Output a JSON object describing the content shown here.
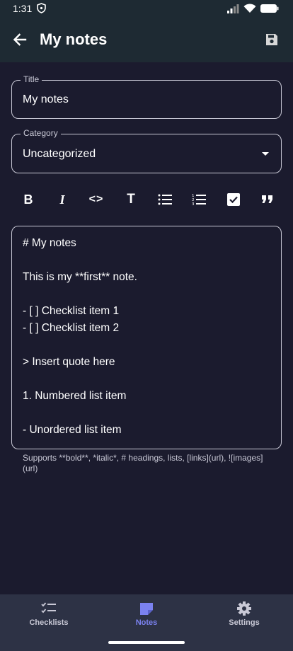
{
  "status_bar": {
    "time": "1:31"
  },
  "app_bar": {
    "title": "My notes"
  },
  "title_field": {
    "label": "Title",
    "value": "My notes"
  },
  "category_field": {
    "label": "Category",
    "value": "Uncategorized"
  },
  "toolbar": {
    "bold_label": "B",
    "italic_label": "I",
    "code_label": "<>",
    "heading_label": "T"
  },
  "editor": {
    "lines": [
      "# My notes",
      "",
      "This is my **first** note.",
      "",
      "- [ ] Checklist item 1",
      "- [ ] Checklist item 2",
      "",
      "> Insert quote here",
      "",
      "1. Numbered list item",
      "",
      "- Unordered list item"
    ]
  },
  "helper_text": "Supports **bold**, *italic*, # headings, lists, [links](url), ![images](url)",
  "bottom_nav": {
    "items": [
      {
        "label": "Checklists",
        "icon": "checklist-icon",
        "active": false
      },
      {
        "label": "Notes",
        "icon": "note-icon",
        "active": true
      },
      {
        "label": "Settings",
        "icon": "gear-icon",
        "active": false
      }
    ],
    "active_color": "#7b82f0"
  }
}
